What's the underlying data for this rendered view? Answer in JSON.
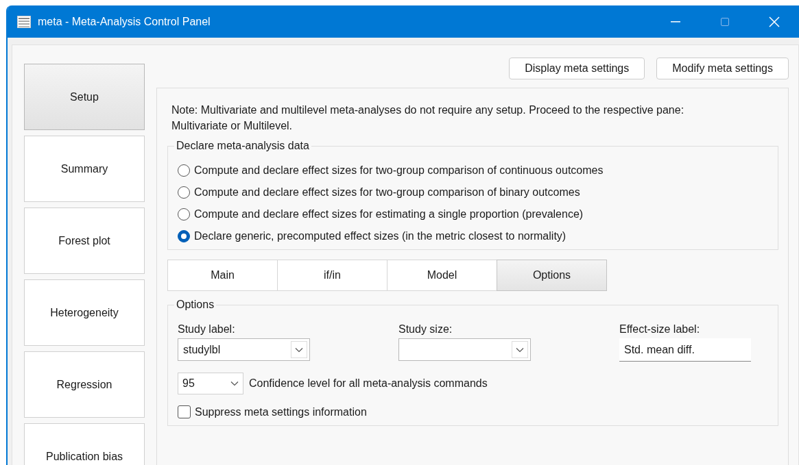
{
  "window": {
    "title": "meta - Meta-Analysis Control Panel"
  },
  "sidebar": {
    "items": [
      {
        "label": "Setup",
        "selected": true
      },
      {
        "label": "Summary",
        "selected": false
      },
      {
        "label": "Forest plot",
        "selected": false
      },
      {
        "label": "Heterogeneity",
        "selected": false
      },
      {
        "label": "Regression",
        "selected": false
      },
      {
        "label": "Publication bias",
        "selected": false
      }
    ]
  },
  "top_buttons": [
    "Display meta settings",
    "Modify meta settings"
  ],
  "note": "Note: Multivariate and multilevel meta-analyses do not require any setup. Proceed to the respective pane: Multivariate or Multilevel.",
  "declare_group": {
    "title": "Declare meta-analysis data",
    "options": [
      {
        "label": "Compute and declare effect sizes for two-group comparison of continuous outcomes",
        "selected": false
      },
      {
        "label": "Compute and declare effect sizes for two-group comparison of binary outcomes",
        "selected": false
      },
      {
        "label": "Compute and declare effect sizes for estimating a single proportion (prevalence)",
        "selected": false
      },
      {
        "label": "Declare generic, precomputed effect sizes (in the metric closest to normality)",
        "selected": true
      }
    ]
  },
  "tabs": [
    {
      "label": "Main",
      "selected": false
    },
    {
      "label": "if/in",
      "selected": false
    },
    {
      "label": "Model",
      "selected": false
    },
    {
      "label": "Options",
      "selected": true
    }
  ],
  "options_group": {
    "title": "Options",
    "study_label": {
      "label": "Study label:",
      "value": "studylbl"
    },
    "study_size": {
      "label": "Study size:"
    },
    "effect_size_label": {
      "label": "Effect-size label:",
      "value": "Std. mean diff."
    },
    "confidence": {
      "value": "95",
      "label": "Confidence level for all meta-analysis commands"
    },
    "suppress": {
      "label": "Suppress meta settings information",
      "checked": false
    }
  }
}
